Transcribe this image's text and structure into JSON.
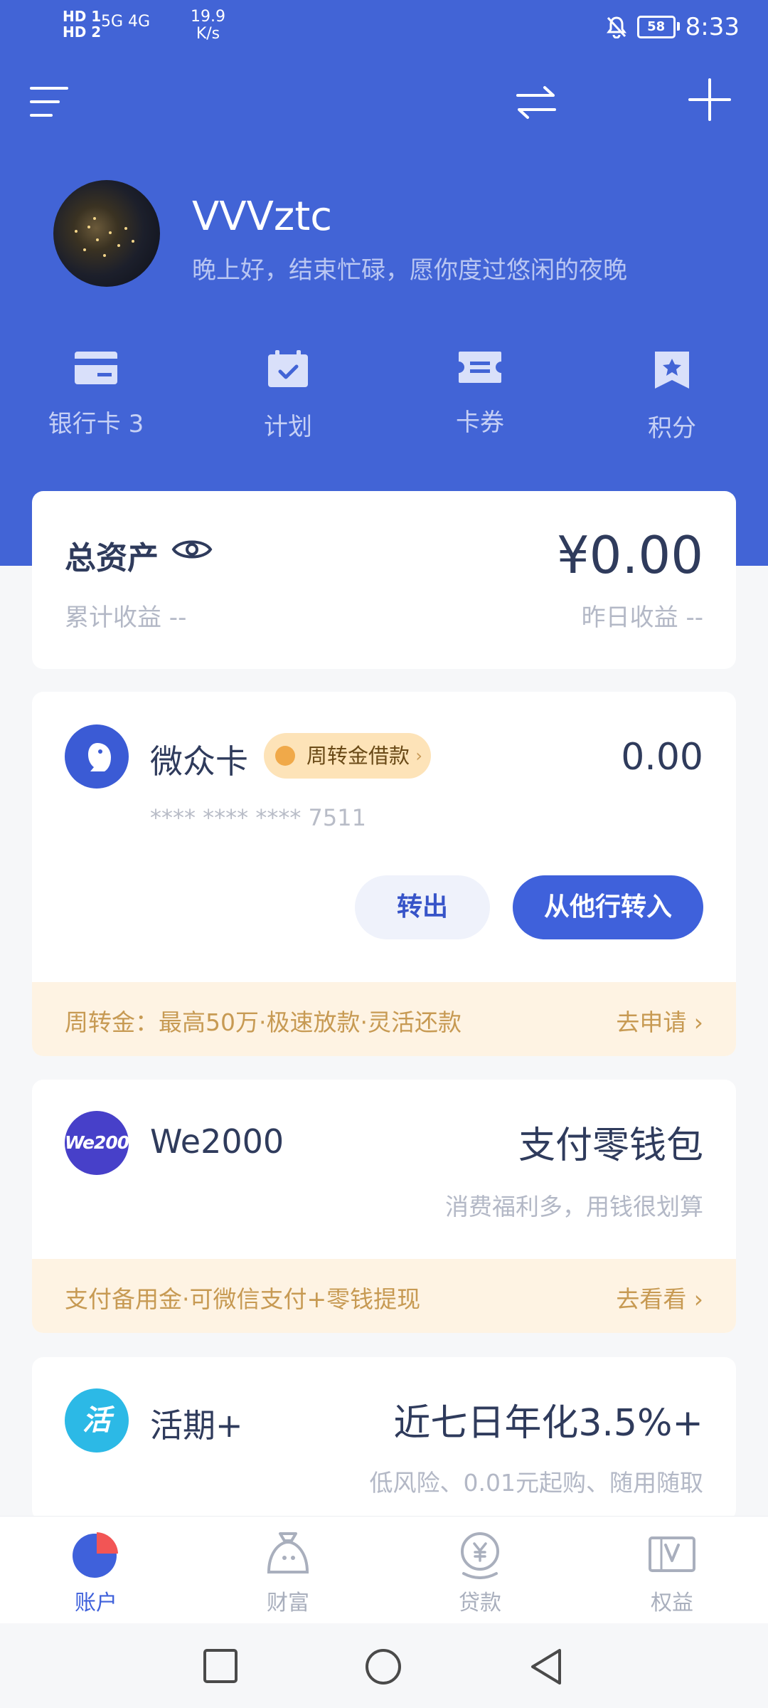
{
  "status_bar": {
    "hd_line1": "HD 1",
    "hd_line2": "HD 2",
    "signal": "5G 4G",
    "speed_value": "19.9",
    "speed_unit": "K/s",
    "battery": "58",
    "time": "8:33"
  },
  "profile": {
    "username": "VVVztc",
    "greeting": "晚上好，结束忙碌，愿你度过悠闲的夜晚"
  },
  "shortcuts": [
    {
      "label": "银行卡 3",
      "icon": "bank-card-icon"
    },
    {
      "label": "计划",
      "icon": "calendar-check-icon"
    },
    {
      "label": "卡券",
      "icon": "coupon-icon"
    },
    {
      "label": "积分",
      "icon": "points-bookmark-icon"
    }
  ],
  "asset": {
    "title": "总资产",
    "amount": "¥0.00",
    "cumulative_label": "累计收益  --",
    "yesterday_label": "昨日收益  --"
  },
  "weizhong": {
    "name": "微众卡",
    "badge": "周转金借款",
    "badge_chevron": "›",
    "amount": "0.00",
    "card_number": "**** **** **** 7511",
    "transfer_out": "转出",
    "transfer_in": "从他行转入",
    "promo_text": "周转金：最高50万·极速放款·灵活还款",
    "promo_action": "去申请 ›"
  },
  "we2000": {
    "icon_text": "We2000",
    "name": "We2000",
    "title": "支付零钱包",
    "subtitle": "消费福利多，用钱很划算",
    "promo_text": "支付备用金·可微信支付+零钱提现",
    "promo_action": "去看看 ›"
  },
  "huoqi": {
    "icon_text": "活",
    "name": "活期+",
    "title": "近七日年化3.5%+",
    "subtitle": "低风险、0.01元起购、随用随取"
  },
  "tabs": [
    {
      "label": "账户",
      "active": true
    },
    {
      "label": "财富",
      "active": false
    },
    {
      "label": "贷款",
      "active": false
    },
    {
      "label": "权益",
      "active": false
    }
  ],
  "colors": {
    "brand_blue": "#4264d6",
    "accent_orange": "#c79a53",
    "text_dark": "#2f3b5c"
  }
}
